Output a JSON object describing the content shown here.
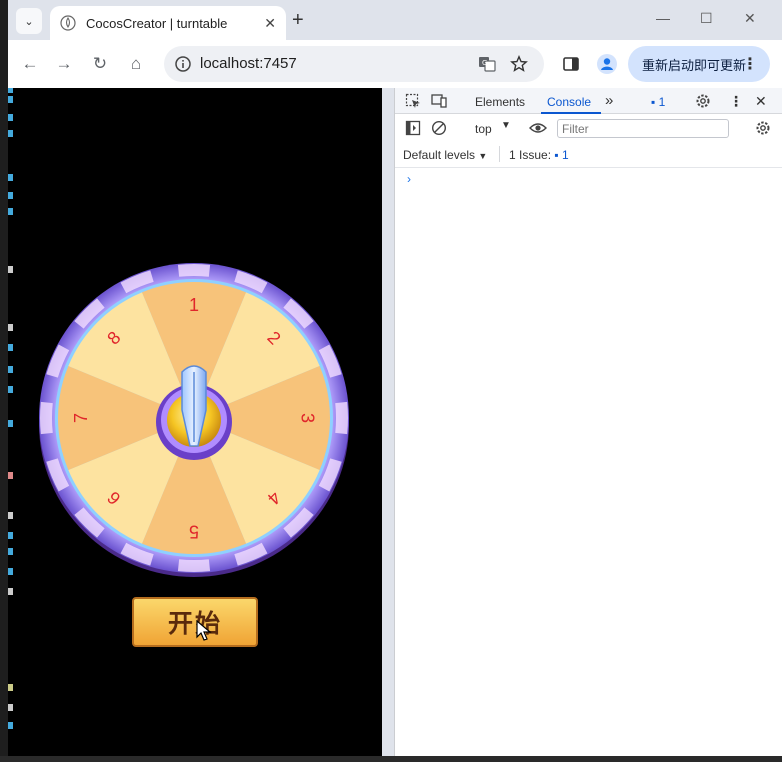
{
  "browser": {
    "tab_title": "CocosCreator | turntable",
    "tab_close": "✕",
    "new_tab": "+",
    "window_controls": {
      "minimize": "—",
      "maximize": "☐",
      "close": "✕"
    },
    "nav": {
      "back": "←",
      "forward": "→",
      "reload": "↻",
      "home": "⌂"
    },
    "url": "localhost:7457",
    "update_button": "重新启动即可更新",
    "menu_dots": "⋮"
  },
  "game": {
    "wheel_numbers": [
      "1",
      "2",
      "3",
      "4",
      "5",
      "6",
      "7",
      "8"
    ],
    "start_button": "开始"
  },
  "devtools": {
    "tabs": [
      "Elements",
      "Console"
    ],
    "active_tab": "Console",
    "more_tabs": "»",
    "issues_badge": "1",
    "context": "top",
    "filter_placeholder": "Filter",
    "default_levels": "Default levels",
    "issues_label": "1 Issue:",
    "issues_count": "1",
    "close": "✕",
    "prompt": "›"
  },
  "colors": {
    "accent": "#0b57d0",
    "wheel_light": "#fde3a0",
    "wheel_dark": "#f7c37a",
    "wheel_rim": "#8a78e8",
    "number_red": "#e0262b"
  }
}
